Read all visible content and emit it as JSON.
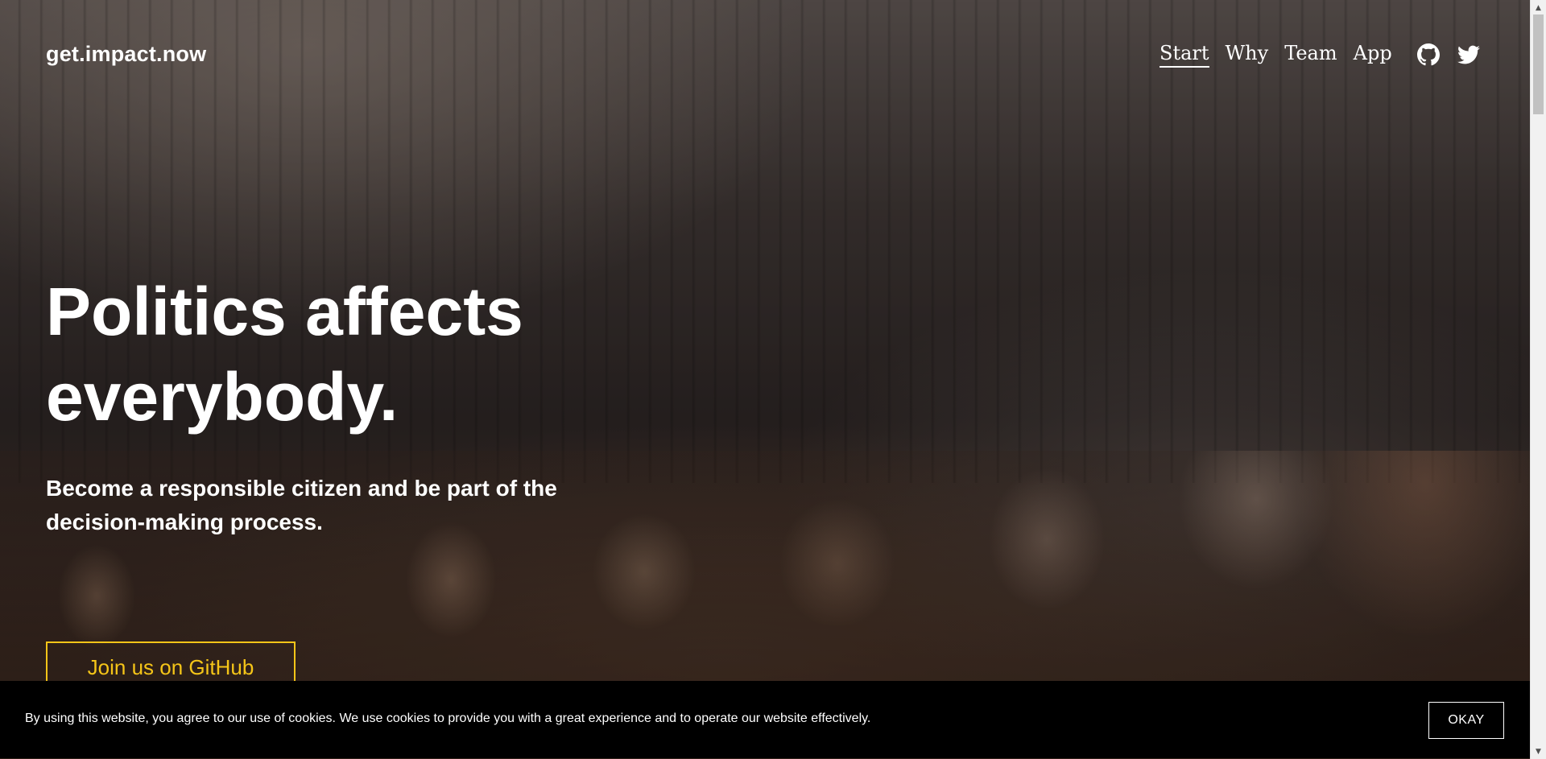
{
  "header": {
    "logo": "get.impact.now",
    "nav": [
      {
        "label": "Start",
        "active": true
      },
      {
        "label": "Why",
        "active": false
      },
      {
        "label": "Team",
        "active": false
      },
      {
        "label": "App",
        "active": false
      }
    ],
    "social": [
      "github-icon",
      "twitter-icon"
    ]
  },
  "hero": {
    "headline_line1": "Politics affects",
    "headline_line2": "everybody.",
    "subhead_line1": "Become a responsible citizen and be part of the",
    "subhead_line2": "decision-making process.",
    "cta_label": "Join us on GitHub",
    "accent_color": "#f5c518"
  },
  "cookie_bar": {
    "text": "By using this website, you agree to our use of cookies. We use cookies to provide you with a great experience and to operate our website effectively.",
    "button_label": "OKAY"
  }
}
